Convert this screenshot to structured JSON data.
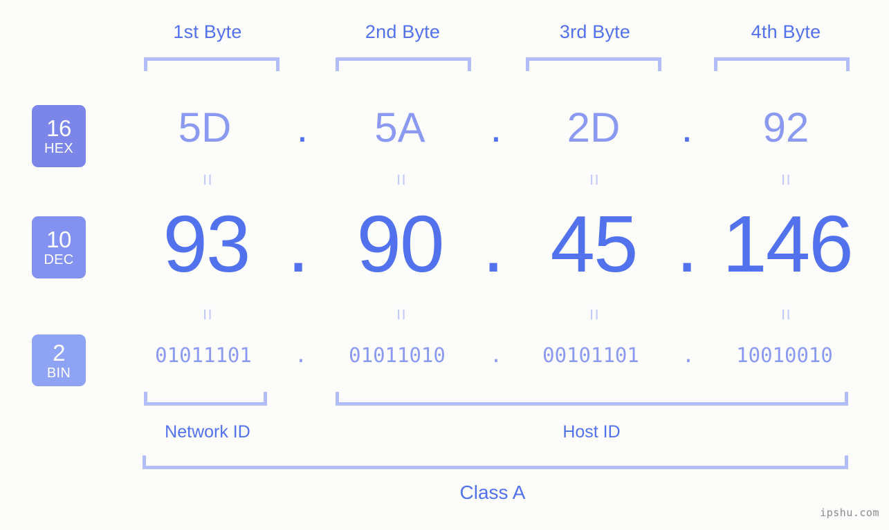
{
  "background_color": "#fcfdfa",
  "accent_color": "#5271ed",
  "muted_accent_color": "#8b9af0",
  "bracket_color": "#b3bdf7",
  "bytes": [
    {
      "header": "1st Byte",
      "hex": "5D",
      "dec": "93",
      "bin": "01011101"
    },
    {
      "header": "2nd Byte",
      "hex": "5A",
      "dec": "90",
      "bin": "01011010"
    },
    {
      "header": "3rd Byte",
      "hex": "2D",
      "dec": "45",
      "bin": "00101101"
    },
    {
      "header": "4th Byte",
      "hex": "92",
      "dec": "146",
      "bin": "10010010"
    }
  ],
  "separators": {
    "hex_dot": ".",
    "dec_dot": ".",
    "bin_dot": "."
  },
  "equals_mark": "=",
  "badges": [
    {
      "id": "hex",
      "number": "16",
      "name": "HEX",
      "color": "#7b86e8"
    },
    {
      "id": "dec",
      "number": "10",
      "name": "DEC",
      "color": "#8391f0"
    },
    {
      "id": "bin",
      "number": "2",
      "name": "BIN",
      "color": "#8fa3f5"
    }
  ],
  "segments": {
    "network_id": "Network ID",
    "host_id": "Host ID"
  },
  "class_label": "Class A",
  "watermark": "ipshu.com",
  "ip_address": {
    "dec": "93.90.45.146",
    "hex": "5D.5A.2D.92",
    "bin": "01011101.01011010.00101101.10010010"
  }
}
